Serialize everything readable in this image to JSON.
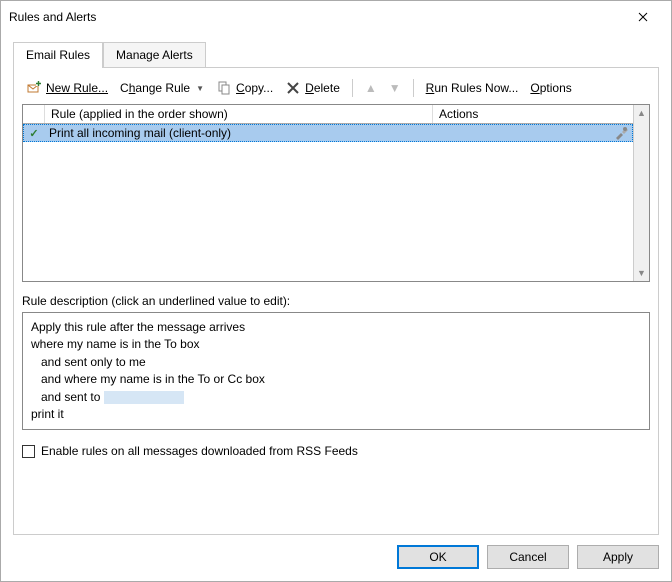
{
  "window": {
    "title": "Rules and Alerts"
  },
  "tabs": {
    "email_rules": "Email Rules",
    "manage_alerts": "Manage Alerts"
  },
  "toolbar": {
    "new_rule": "New Rule...",
    "change_rule": "Change Rule",
    "copy": "Copy...",
    "delete": "Delete",
    "run_rules_now": "Run Rules Now...",
    "options": "Options"
  },
  "columns": {
    "rule": "Rule (applied in the order shown)",
    "actions": "Actions"
  },
  "rules": [
    {
      "checked": true,
      "name": "Print all incoming mail  (client-only)",
      "action_icon": "hammer-wrench"
    }
  ],
  "description": {
    "label": "Rule description (click an underlined value to edit):",
    "line1": "Apply this rule after the message arrives",
    "line2": "where my name is in the To box",
    "line3": "and sent only to me",
    "line4": "and where my name is in the To or Cc box",
    "line5_prefix": "and sent to ",
    "line6": "print it"
  },
  "rss_checkbox": {
    "label": "Enable rules on all messages downloaded from RSS Feeds",
    "checked": false
  },
  "buttons": {
    "ok": "OK",
    "cancel": "Cancel",
    "apply": "Apply"
  }
}
